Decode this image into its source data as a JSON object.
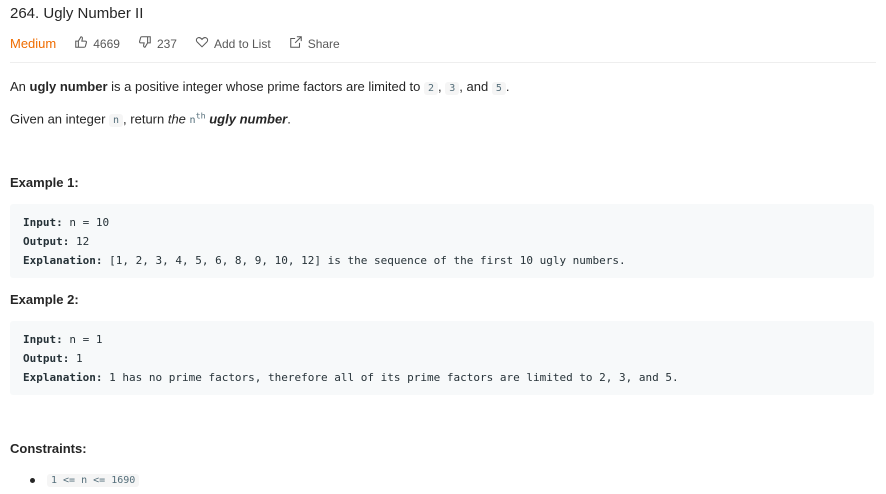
{
  "problem": {
    "title": "264. Ugly Number II",
    "difficulty": "Medium",
    "likes": "4669",
    "dislikes": "237",
    "add_to_list": "Add to List",
    "share": "Share"
  },
  "description": {
    "p1_prefix": "An ",
    "p1_bold": "ugly number",
    "p1_mid": " is a positive integer whose prime factors are limited to ",
    "p1_code1": "2",
    "p1_sep1": ", ",
    "p1_code2": "3",
    "p1_sep2": ", and ",
    "p1_code3": "5",
    "p1_end": ".",
    "p2_prefix": "Given an integer ",
    "p2_code": "n",
    "p2_mid": ", return ",
    "p2_italic_the": "the",
    "p2_nth_base": "n",
    "p2_nth_sup": "th",
    "p2_bold_italic": "ugly number",
    "p2_end": "."
  },
  "examples": [
    {
      "heading": "Example 1:",
      "input_label": "Input:",
      "input_value": " n = 10",
      "output_label": "Output:",
      "output_value": " 12",
      "explanation_label": "Explanation:",
      "explanation_value": " [1, 2, 3, 4, 5, 6, 8, 9, 10, 12] is the sequence of the first 10 ugly numbers."
    },
    {
      "heading": "Example 2:",
      "input_label": "Input:",
      "input_value": " n = 1",
      "output_label": "Output:",
      "output_value": " 1",
      "explanation_label": "Explanation:",
      "explanation_value": " 1 has no prime factors, therefore all of its prime factors are limited to 2, 3, and 5."
    }
  ],
  "constraints": {
    "heading": "Constraints:",
    "items": [
      "1 <= n <= 1690"
    ]
  },
  "colors": {
    "difficulty_medium": "#ef6c00",
    "code_bg": "#f7f9fa"
  }
}
